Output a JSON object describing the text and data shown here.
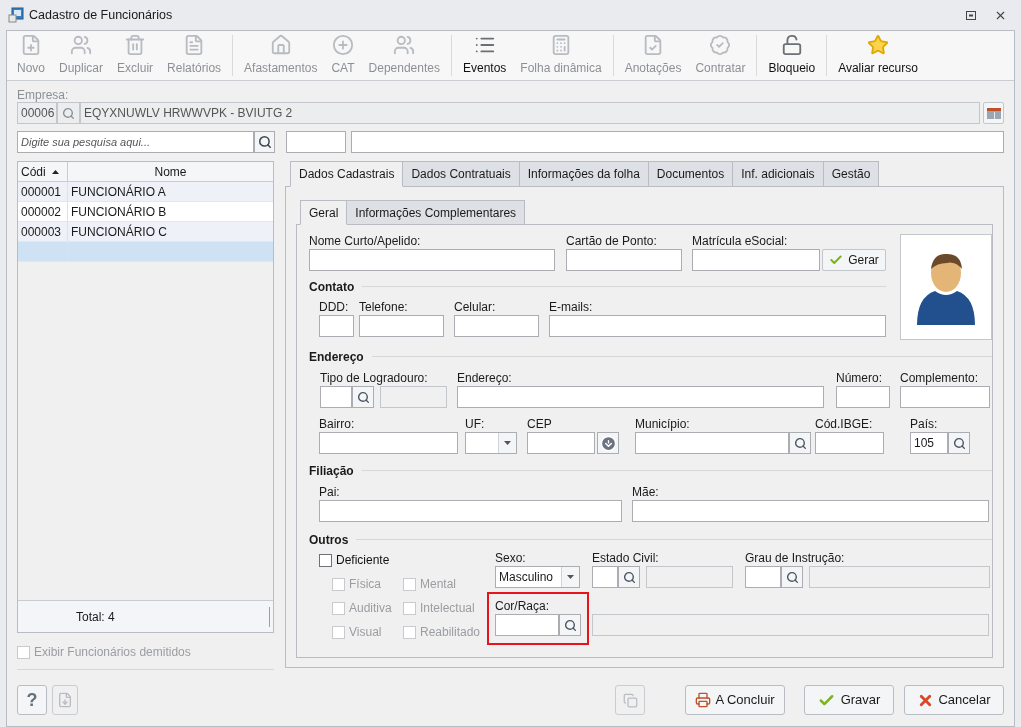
{
  "window": {
    "title": "Cadastro de Funcionários"
  },
  "toolbar": [
    {
      "label": "Novo",
      "disabled": true
    },
    {
      "label": "Duplicar",
      "disabled": true
    },
    {
      "label": "Excluir",
      "disabled": true
    },
    {
      "label": "Relatórios",
      "disabled": true
    },
    {
      "label": "Afastamentos",
      "disabled": true
    },
    {
      "label": "CAT",
      "disabled": true
    },
    {
      "label": "Dependentes",
      "disabled": true
    },
    {
      "label": "Eventos",
      "disabled": false
    },
    {
      "label": "Folha dinâmica",
      "disabled": true
    },
    {
      "label": "Anotações",
      "disabled": true
    },
    {
      "label": "Contratar",
      "disabled": true
    },
    {
      "label": "Bloqueio",
      "disabled": false
    },
    {
      "label": "Avaliar recurso",
      "disabled": false
    }
  ],
  "empresa": {
    "label": "Empresa:",
    "code": "00006",
    "name": "EQYXNUWLV HRWWVPK - BVIUTG 2"
  },
  "search": {
    "placeholder": "Digite sua pesquisa aqui..."
  },
  "grid": {
    "columns": [
      {
        "label": "Códi",
        "sorted": true
      },
      {
        "label": "Nome",
        "sorted": false
      }
    ],
    "rows": [
      {
        "code": "000001",
        "name": "FUNCIONÁRIO A",
        "selected": false
      },
      {
        "code": "000002",
        "name": "FUNCIONÁRIO B",
        "selected": false
      },
      {
        "code": "000003",
        "name": "FUNCIONÁRIO C",
        "selected": false
      },
      {
        "selected": true
      }
    ],
    "footer": "Total: 4"
  },
  "show_dismissed": {
    "label": "Exibir Funcionários demitidos",
    "checked": false,
    "disabled": true
  },
  "tabs": [
    {
      "label": "Dados Cadastrais",
      "selected": true
    },
    {
      "label": "Dados Contratuais",
      "selected": false
    },
    {
      "label": "Informações da folha",
      "selected": false
    },
    {
      "label": "Documentos",
      "selected": false
    },
    {
      "label": "Inf. adicionais",
      "selected": false
    },
    {
      "label": "Gestão",
      "selected": false
    }
  ],
  "subtabs": [
    {
      "label": "Geral",
      "selected": true
    },
    {
      "label": "Informações Complementares",
      "selected": false
    }
  ],
  "form": {
    "geral": {
      "fields": [
        {
          "label": "Nome Curto/Apelido:",
          "kind": "text"
        },
        {
          "label": "Cartão de Ponto:",
          "kind": "text"
        },
        {
          "label": "Matrícula eSocial:",
          "kind": "text"
        }
      ],
      "generate_button": "Gerar"
    },
    "contato": {
      "title": "Contato",
      "fields": [
        {
          "label": "DDD:",
          "kind": "text"
        },
        {
          "label": "Telefone:",
          "kind": "text"
        },
        {
          "label": "Celular:",
          "kind": "text"
        },
        {
          "label": "E-mails:",
          "kind": "text"
        }
      ]
    },
    "endereco": {
      "title": "Endereço",
      "fields": [
        {
          "label": "Tipo de Logradouro:",
          "kind": "lookup_desc"
        },
        {
          "label": "Endereço:",
          "kind": "text"
        },
        {
          "label": "Número:",
          "kind": "text"
        },
        {
          "label": "Complemento:",
          "kind": "text"
        },
        {
          "label": "Bairro:",
          "kind": "text"
        },
        {
          "label": "UF:",
          "kind": "select"
        },
        {
          "label": "CEP",
          "kind": "cep"
        },
        {
          "label": "Município:",
          "kind": "lookup"
        },
        {
          "label": "Cód.IBGE:",
          "kind": "text"
        },
        {
          "label": "País:",
          "kind": "lookup",
          "value": "105"
        }
      ]
    },
    "filiacao": {
      "title": "Filiação",
      "fields": [
        {
          "label": "Pai:",
          "kind": "text"
        },
        {
          "label": "Mãe:",
          "kind": "text"
        }
      ]
    },
    "outros": {
      "title": "Outros",
      "deficiente": {
        "label": "Deficiente",
        "checked": false,
        "disabled": false
      },
      "deficiencias": [
        {
          "label": "Física",
          "checked": false,
          "disabled": true
        },
        {
          "label": "Mental",
          "checked": false,
          "disabled": true
        },
        {
          "label": "Auditiva",
          "checked": false,
          "disabled": true
        },
        {
          "label": "Intelectual",
          "checked": false,
          "disabled": true
        },
        {
          "label": "Visual",
          "checked": false,
          "disabled": true
        },
        {
          "label": "Reabilitado",
          "checked": false,
          "disabled": true
        }
      ],
      "sexo": {
        "label": "Sexo:",
        "kind": "select",
        "value": "Masculino"
      },
      "estado_civil": {
        "label": "Estado Civil:",
        "kind": "lookup_desc"
      },
      "grau_instrucao": {
        "label": "Grau de Instrução:",
        "kind": "lookup_desc"
      },
      "cor_raca": {
        "label": "Cor/Raça:",
        "kind": "lookup",
        "highlighted": true
      }
    }
  },
  "help_button": {
    "label": "?"
  },
  "export_button": {
    "disabled": true
  },
  "copy_button": {
    "disabled": true
  },
  "buttons": [
    {
      "label": "A Concluir",
      "kind": "conclude"
    },
    {
      "label": "Gravar",
      "kind": "save"
    },
    {
      "label": "Cancelar",
      "kind": "cancel"
    }
  ]
}
